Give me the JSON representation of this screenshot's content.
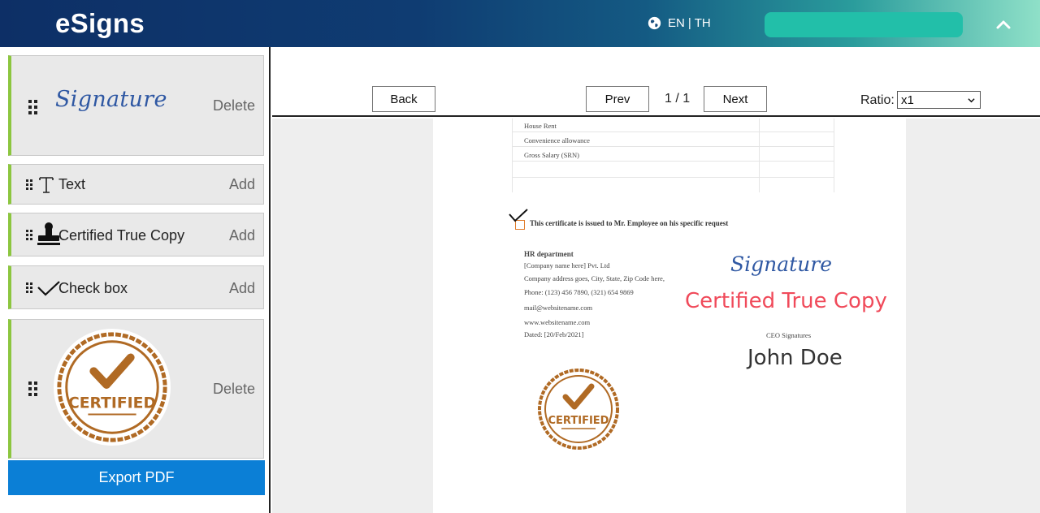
{
  "header": {
    "app_name": "eSigns",
    "lang_en": "EN",
    "lang_sep": "|",
    "lang_th": "TH",
    "colors": {
      "gradient_start": "#0d2f66",
      "gradient_end": "#8fe0c8",
      "pill": "#22bfa9"
    }
  },
  "sidebar": {
    "items": [
      {
        "kind": "signature",
        "preview_text": "Signature",
        "action": "Delete"
      },
      {
        "kind": "text",
        "label": "Text",
        "action": "Add",
        "icon": "text-cursor-icon"
      },
      {
        "kind": "certified-true-copy",
        "label": "Certified True Copy",
        "action": "Add",
        "icon": "stamp-icon"
      },
      {
        "kind": "checkbox",
        "label": "Check box",
        "action": "Add",
        "icon": "checkmark-icon"
      },
      {
        "kind": "stamp-image",
        "stamp_text": "CERTIFIED",
        "action": "Delete"
      }
    ],
    "export_label": "Export PDF",
    "colors": {
      "accent_bar": "#8cc63f",
      "export_bg": "#0b7fd6",
      "stamp": "#b06a24"
    }
  },
  "toolbar": {
    "back_label": "Back",
    "prev_label": "Prev",
    "page_indicator": "1 / 1",
    "next_label": "Next",
    "ratio_label": "Ratio:",
    "ratio_value": "x1"
  },
  "document": {
    "table_rows": [
      "House Rent",
      "Convenience allowance",
      "Gross Salary  (SRN)"
    ],
    "cert_statement": "This certificate is issued to Mr. Employee on his specific request",
    "hr_heading": "HR department",
    "address_lines": [
      "[Company name here] Pvt. Ltd",
      "Company address goes, City, State, Zip Code  here,",
      "Phone: (123) 456 7890,  (321) 654 9869",
      "mail@websitename.com",
      "www.websitename.com",
      "Dated: [20/Feb/2021]"
    ],
    "signature_text": "Signature",
    "ctc_text": "Certified True Copy",
    "ceo_label": "CEO Signatures",
    "signer_name": "John Doe",
    "stamp_text": "CERTIFIED",
    "colors": {
      "signature": "#2f58a3",
      "ctc": "#f04a5a"
    }
  }
}
